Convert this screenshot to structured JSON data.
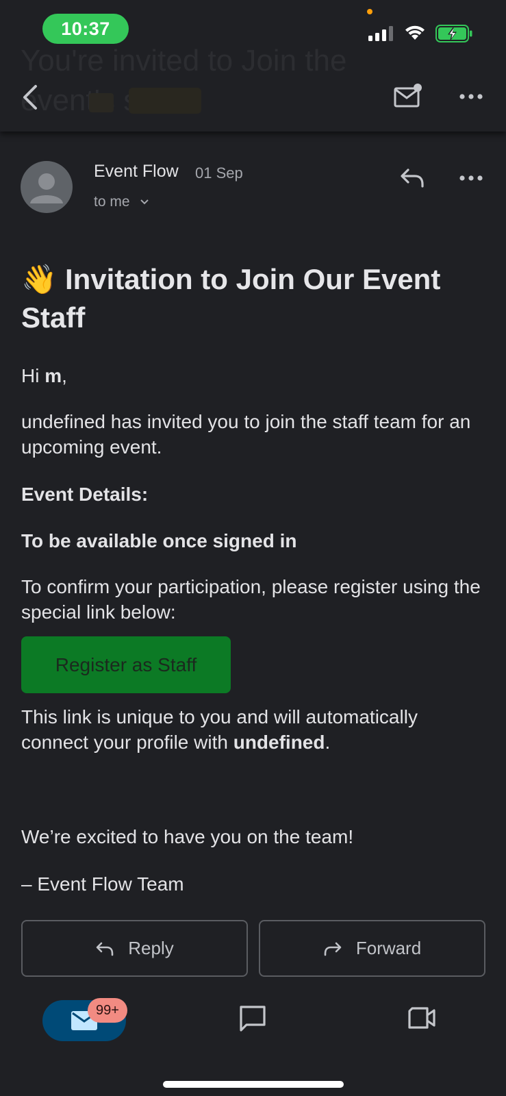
{
  "status_bar": {
    "time": "10:37",
    "battery_color": "#34c759"
  },
  "app_bar": {
    "ghost_title": "You're invited to Join the event's staff",
    "ghost_chip": "External"
  },
  "message_header": {
    "sender": "Event Flow",
    "date": "01 Sep",
    "recipient": "to me"
  },
  "email": {
    "emoji": "👋",
    "heading": "Invitation to Join Our Event Staff",
    "greeting_prefix": "Hi ",
    "greeting_name": "m",
    "greeting_suffix": ",",
    "intro": "undefined has invited you to join the staff team for an upcoming event.",
    "details_label": "Event Details:",
    "details_value": "To be available once signed in",
    "confirm_text": "To confirm your participation, please register using the special link below:",
    "register_button": "Register as Staff",
    "unique_prefix": "This link is unique to you and will automatically connect your profile with ",
    "unique_bold": "undefined",
    "unique_suffix": ".",
    "closing": "We’re excited to have you on the team!",
    "signature": "– Event Flow Team"
  },
  "actions": {
    "reply": "Reply",
    "forward": "Forward"
  },
  "bottom_nav": {
    "mail_badge": "99+",
    "active_tab_color": "#004a77",
    "badge_color": "#f28b82"
  }
}
